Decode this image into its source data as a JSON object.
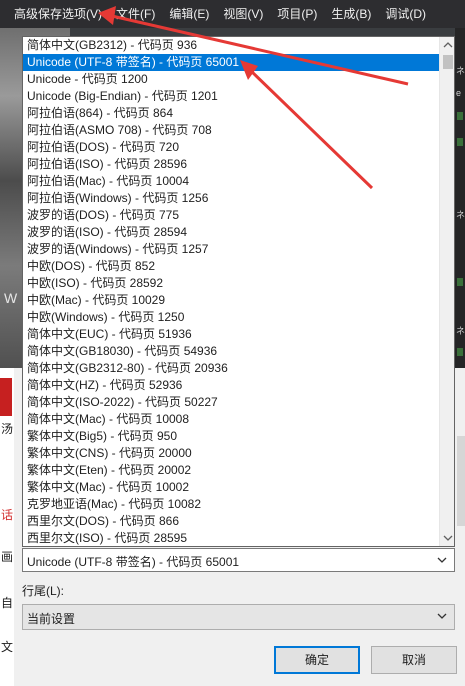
{
  "menubar": {
    "items": [
      {
        "label": "高级保存选项(V)"
      },
      {
        "label": "文件(F)"
      },
      {
        "label": "编辑(E)"
      },
      {
        "label": "视图(V)"
      },
      {
        "label": "项目(P)"
      },
      {
        "label": "生成(B)"
      },
      {
        "label": "调试(D)"
      }
    ]
  },
  "background": {
    "photo_caption": "W",
    "side_glyphs": [
      "ネ",
      "e",
      "ネ",
      "ネ"
    ]
  },
  "encoding_dropdown": {
    "items": [
      {
        "label": "简体中文(GB2312) - 代码页 936"
      },
      {
        "label": "Unicode (UTF-8 带签名) - 代码页 65001",
        "selected": true
      },
      {
        "label": "Unicode - 代码页 1200"
      },
      {
        "label": "Unicode (Big-Endian) - 代码页 1201"
      },
      {
        "label": "阿拉伯语(864) - 代码页 864"
      },
      {
        "label": "阿拉伯语(ASMO 708) - 代码页 708"
      },
      {
        "label": "阿拉伯语(DOS) - 代码页 720"
      },
      {
        "label": "阿拉伯语(ISO) - 代码页 28596"
      },
      {
        "label": "阿拉伯语(Mac) - 代码页 10004"
      },
      {
        "label": "阿拉伯语(Windows) - 代码页 1256"
      },
      {
        "label": "波罗的语(DOS) - 代码页 775"
      },
      {
        "label": "波罗的语(ISO) - 代码页 28594"
      },
      {
        "label": "波罗的语(Windows) - 代码页 1257"
      },
      {
        "label": "中欧(DOS) - 代码页 852"
      },
      {
        "label": "中欧(ISO) - 代码页 28592"
      },
      {
        "label": "中欧(Mac) - 代码页 10029"
      },
      {
        "label": "中欧(Windows) - 代码页 1250"
      },
      {
        "label": "简体中文(EUC) - 代码页 51936"
      },
      {
        "label": "简体中文(GB18030) - 代码页 54936"
      },
      {
        "label": "简体中文(GB2312-80) - 代码页 20936"
      },
      {
        "label": "简体中文(HZ) - 代码页 52936"
      },
      {
        "label": "简体中文(ISO-2022) - 代码页 50227"
      },
      {
        "label": "简体中文(Mac) - 代码页 10008"
      },
      {
        "label": "繁体中文(Big5) - 代码页 950"
      },
      {
        "label": "繁体中文(CNS) - 代码页 20000"
      },
      {
        "label": "繁体中文(Eten) - 代码页 20002"
      },
      {
        "label": "繁体中文(Mac) - 代码页 10002"
      },
      {
        "label": "克罗地亚语(Mac) - 代码页 10082"
      },
      {
        "label": "西里尔文(DOS) - 代码页 866"
      },
      {
        "label": "西里尔文(ISO) - 代码页 28595"
      }
    ]
  },
  "dialog": {
    "encoding_value": "Unicode (UTF-8 带签名) - 代码页 65001",
    "line_ending_label": "行尾(L):",
    "line_ending_value": "当前设置",
    "ok_label": "确定",
    "cancel_label": "取消",
    "side_glyphs": [
      "汤",
      "话",
      "画",
      "自",
      "文"
    ]
  },
  "colors": {
    "menubar_bg": "#2d2d30",
    "selection": "#0078d7",
    "annotation_arrow": "#e53935"
  }
}
